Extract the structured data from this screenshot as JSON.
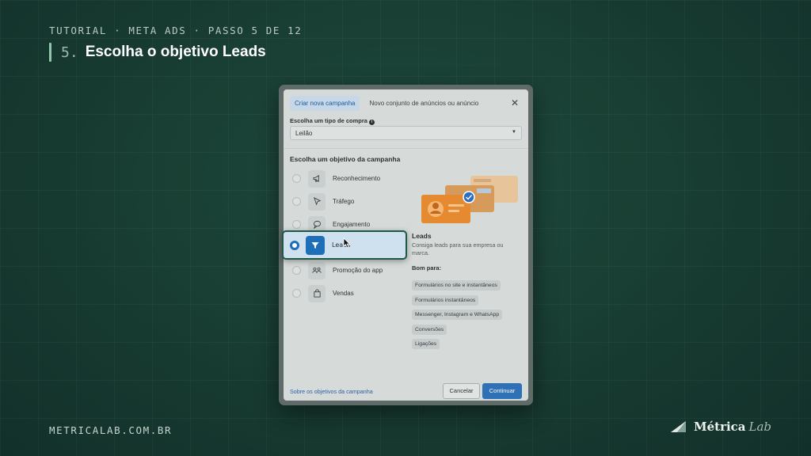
{
  "header": {
    "eyebrow": "TUTORIAL · META ADS · PASSO 5 DE 12",
    "step_number": "5.",
    "step_title": "Escolha o objetivo Leads"
  },
  "footer": {
    "url": "METRICALAB.COM.BR",
    "brand_name": "Métrica",
    "brand_sub": "Lab"
  },
  "dialog": {
    "tabs": [
      {
        "label": "Criar nova campanha",
        "active": true
      },
      {
        "label": "Novo conjunto de anúncios ou anúncio",
        "active": false
      }
    ],
    "close_icon": "close-icon",
    "purchase_type_label": "Escolha um tipo de compra",
    "purchase_type_value": "Leilão",
    "objective_section_title": "Escolha um objetivo da campanha",
    "objectives": [
      {
        "label": "Reconhecimento",
        "icon": "megaphone-icon"
      },
      {
        "label": "Tráfego",
        "icon": "cursor-icon"
      },
      {
        "label": "Engajamento",
        "icon": "chat-icon"
      },
      {
        "label": "Leads",
        "icon": "funnel-icon",
        "selected": true
      },
      {
        "label": "Promoção do app",
        "icon": "people-icon"
      },
      {
        "label": "Vendas",
        "icon": "bag-icon"
      }
    ],
    "detail": {
      "title": "Leads",
      "description": "Consiga leads para sua empresa ou marca.",
      "good_for_label": "Bom para:",
      "chips": [
        "Formulários no site e instantâneos",
        "Formulários instantâneos",
        "Messenger, Instagram e WhatsApp",
        "Conversões",
        "Ligações"
      ]
    },
    "footer_link": "Sobre os objetivos da campanha",
    "cancel_label": "Cancelar",
    "continue_label": "Continuar"
  },
  "colors": {
    "background": "#173a30",
    "accent": "#8fc7ab",
    "highlight_border": "#1c5a47",
    "primary_button": "#2f71b4"
  }
}
